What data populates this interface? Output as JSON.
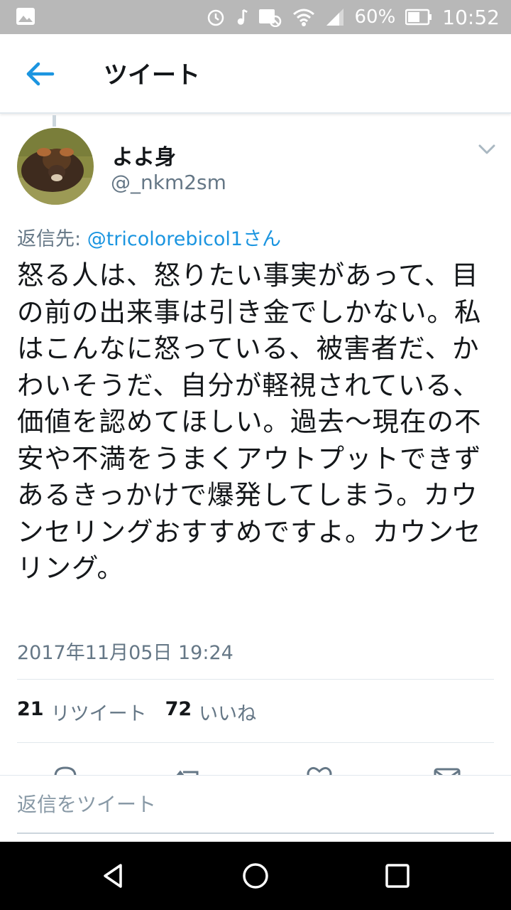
{
  "status_bar": {
    "battery_percent": "60%",
    "time": "10:52"
  },
  "header": {
    "title": "ツイート"
  },
  "tweet": {
    "display_name": "よよ身",
    "username": "@_nkm2sm",
    "reply_prefix": "返信先: ",
    "reply_handle": "@tricolorebicol1さん",
    "text": "怒る人は、怒りたい事実があって、目の前の出来事は引き金でしかない。私はこんなに怒っている、被害者だ、かわいそうだ、自分が軽視されている、価値を認めてほしい。過去〜現在の不安や不満をうまくアウトプットできずあるきっかけで爆発してしまう。カウンセリングおすすめですよ。カウンセリング。",
    "timestamp": "2017年11月05日 19:24",
    "retweet_count": "21",
    "retweet_label": "リツイート",
    "like_count": "72",
    "like_label": "いいね"
  },
  "reply_bar": {
    "placeholder": "返信をツイート"
  },
  "colors": {
    "accent": "#1b95e0",
    "secondary_text": "#657786",
    "status_bar": "#b8b8b8"
  }
}
